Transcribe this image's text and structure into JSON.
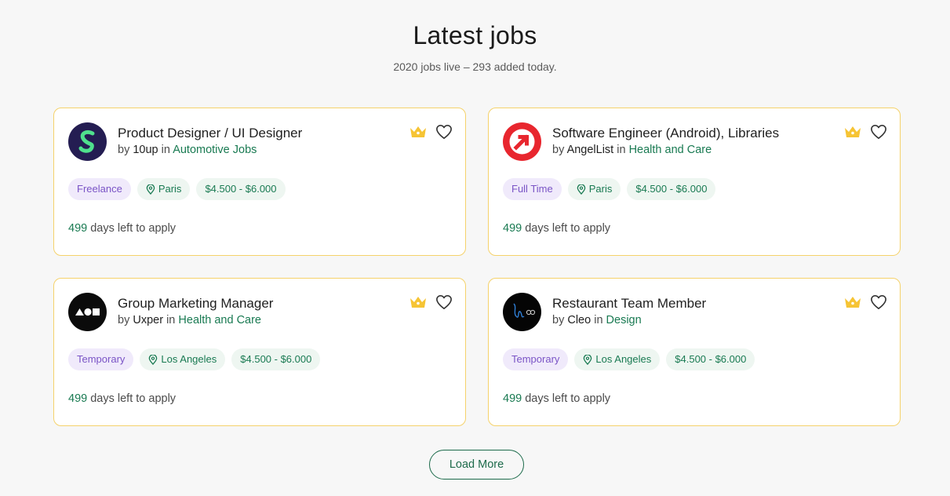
{
  "page": {
    "title": "Latest jobs",
    "subtitle": "2020 jobs live – 293 added today."
  },
  "accent": "#197a52",
  "jobs": [
    {
      "title": "Product Designer / UI Designer",
      "by": "by",
      "company": "10up",
      "in": "in",
      "category": "Automotive Jobs",
      "type": "Freelance",
      "location": "Paris",
      "salary": "$4.500 - $6.000",
      "days": "499",
      "days_suffix": "days left to apply",
      "logo": "10up-logo"
    },
    {
      "title": "Software Engineer (Android), Libraries",
      "by": "by",
      "company": "AngelList",
      "in": "in",
      "category": "Health and Care",
      "type": "Full Time",
      "location": "Paris",
      "salary": "$4.500 - $6.000",
      "days": "499",
      "days_suffix": "days left to apply",
      "logo": "angellist-logo"
    },
    {
      "title": "Group Marketing Manager",
      "by": "by",
      "company": "Uxper",
      "in": "in",
      "category": "Health and Care",
      "type": "Temporary",
      "location": "Los Angeles",
      "salary": "$4.500 - $6.000",
      "days": "499",
      "days_suffix": "days left to apply",
      "logo": "uxper-logo"
    },
    {
      "title": "Restaurant Team Member",
      "by": "by",
      "company": "Cleo",
      "in": "in",
      "category": "Design",
      "type": "Temporary",
      "location": "Los Angeles",
      "salary": "$4.500 - $6.000",
      "days": "499",
      "days_suffix": "days left to apply",
      "logo": "cleo-logo"
    }
  ],
  "load_more": "Load More"
}
